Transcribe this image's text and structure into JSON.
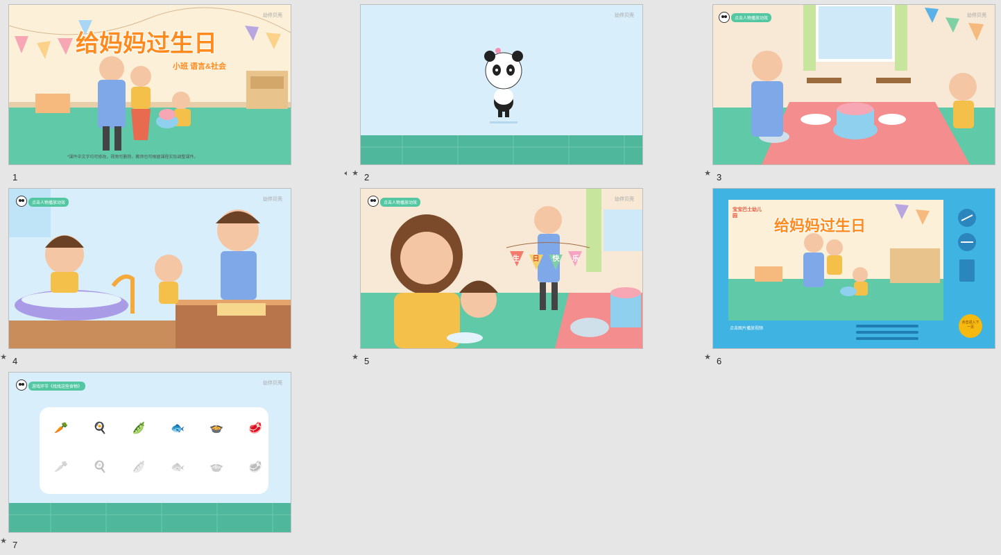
{
  "slides": [
    {
      "number": "1",
      "title": "给妈妈过生日",
      "subtitle": "小班  语言&社会",
      "note": "*课件中文字均可修改，视频可删除，教师也可根据课程实际调整课件。",
      "watermark": "幼伴贝壳",
      "icons": []
    },
    {
      "number": "2",
      "watermark": "幼伴贝壳",
      "icons": [
        "speaker-icon",
        "star-icon"
      ]
    },
    {
      "number": "3",
      "tag": "点击人物播放动效",
      "watermark": "幼伴贝壳",
      "icons": [
        "star-icon"
      ]
    },
    {
      "number": "4",
      "tag": "点击人物播放动效",
      "watermark": "幼伴贝壳",
      "icons": [
        "star-icon"
      ]
    },
    {
      "number": "5",
      "tag": "点击人物播放动效",
      "banner": [
        "生",
        "日",
        "快",
        "乐"
      ],
      "watermark": "幼伴贝壳",
      "icons": [
        "star-icon"
      ]
    },
    {
      "number": "6",
      "title": "给妈妈过生日",
      "logo": "宝宝巴士幼儿园",
      "caption": "点击图片播放视频",
      "next_button": "点击进入下一页",
      "icons": [
        "star-icon"
      ]
    },
    {
      "number": "7",
      "tag": "游戏环节《找找这些食物》",
      "watermark": "幼伴贝壳",
      "icons": [
        "star-icon"
      ]
    }
  ],
  "colors": {
    "accent_orange": "#ff8a1e",
    "tag_green": "#52c7a2",
    "sky": "#d9eefb",
    "floor": "#5fc9a8",
    "blue_frame": "#3fb3e2"
  }
}
